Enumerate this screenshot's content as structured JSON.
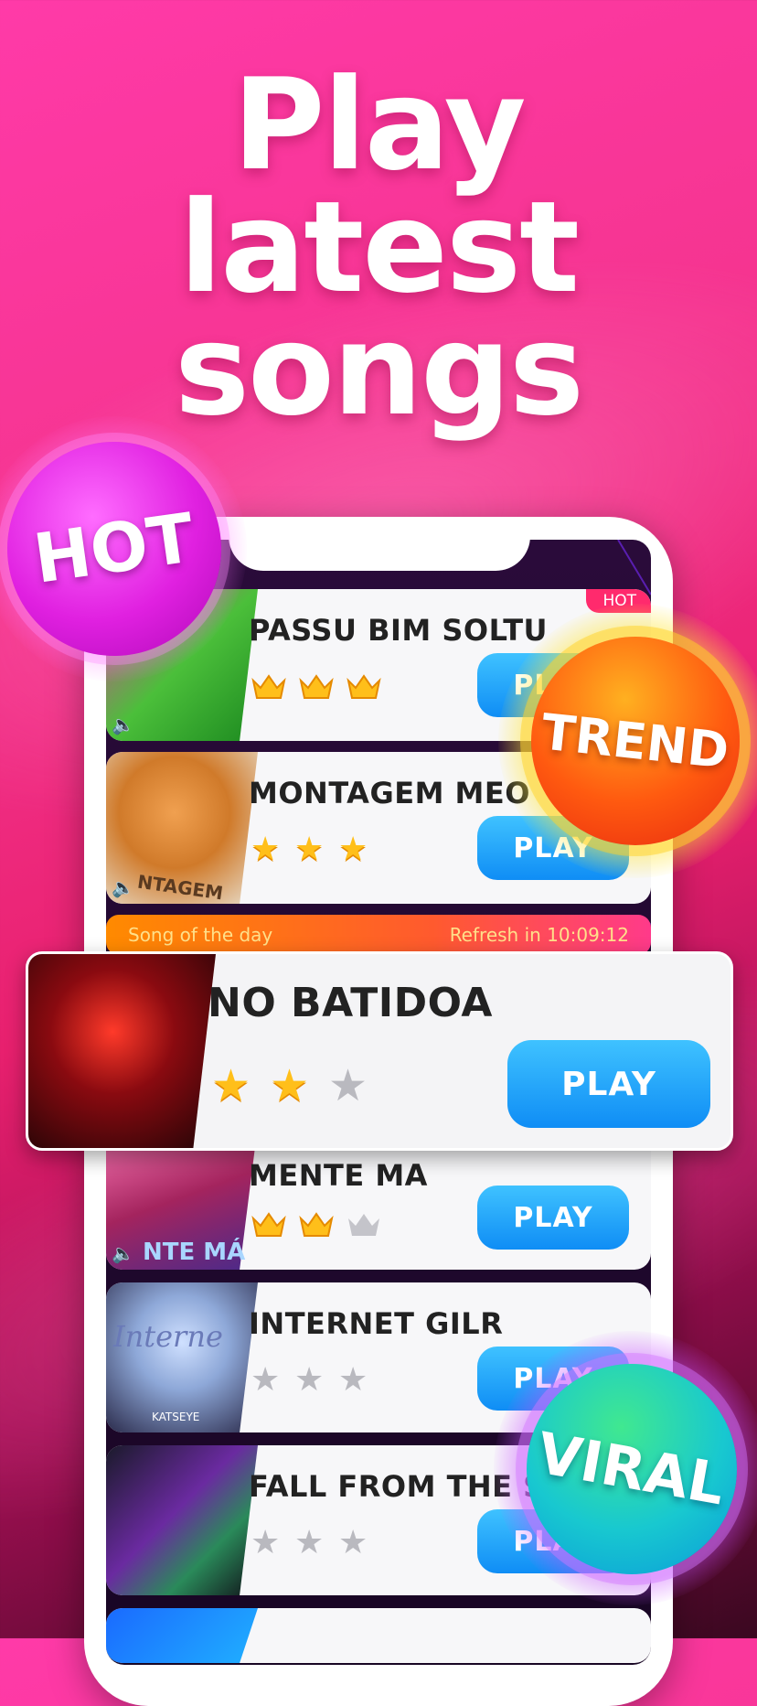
{
  "headline": [
    "Play",
    "latest",
    "songs"
  ],
  "badges": {
    "hot": "HOT",
    "trend": "TREND",
    "viral": "VIRAL"
  },
  "song_of_the_day": {
    "label": "Song of the day",
    "refresh": "Refresh in 10:09:12"
  },
  "songs": [
    {
      "title": "PASSU BIM SOLTU",
      "tag": "HOT",
      "play": "PLAY",
      "rating": 3,
      "rating_max": 3,
      "star_style": "crown"
    },
    {
      "title": "MONTAGEM MEO",
      "play": "PLAY",
      "rating": 3,
      "rating_max": 3,
      "star_style": "star",
      "thumb_text": "NTAGEM"
    },
    {
      "title": "MENTE MA",
      "play": "PLAY",
      "rating": 2,
      "rating_max": 3,
      "star_style": "crown",
      "thumb_text": "NTE MÁ"
    },
    {
      "title": "INTERNET GILR",
      "play": "PLAY",
      "rating": 0,
      "rating_max": 3,
      "star_style": "star",
      "thumb_text": "Interne",
      "thumb_sub": "KATSEYE"
    },
    {
      "title": "FALL FROM THE S",
      "play": "PLAY",
      "rating": 0,
      "rating_max": 3,
      "star_style": "star"
    }
  ],
  "featured": {
    "title": "NO BATIDOA",
    "play": "PLAY",
    "rating": 2,
    "rating_max": 3
  },
  "colors": {
    "play_button": "#1a9bf7",
    "gold_star": "#ffbf1a",
    "hot_badge": "#e020e0",
    "trend_badge": "#ff4a10",
    "viral_badge": "#10c8d8"
  }
}
